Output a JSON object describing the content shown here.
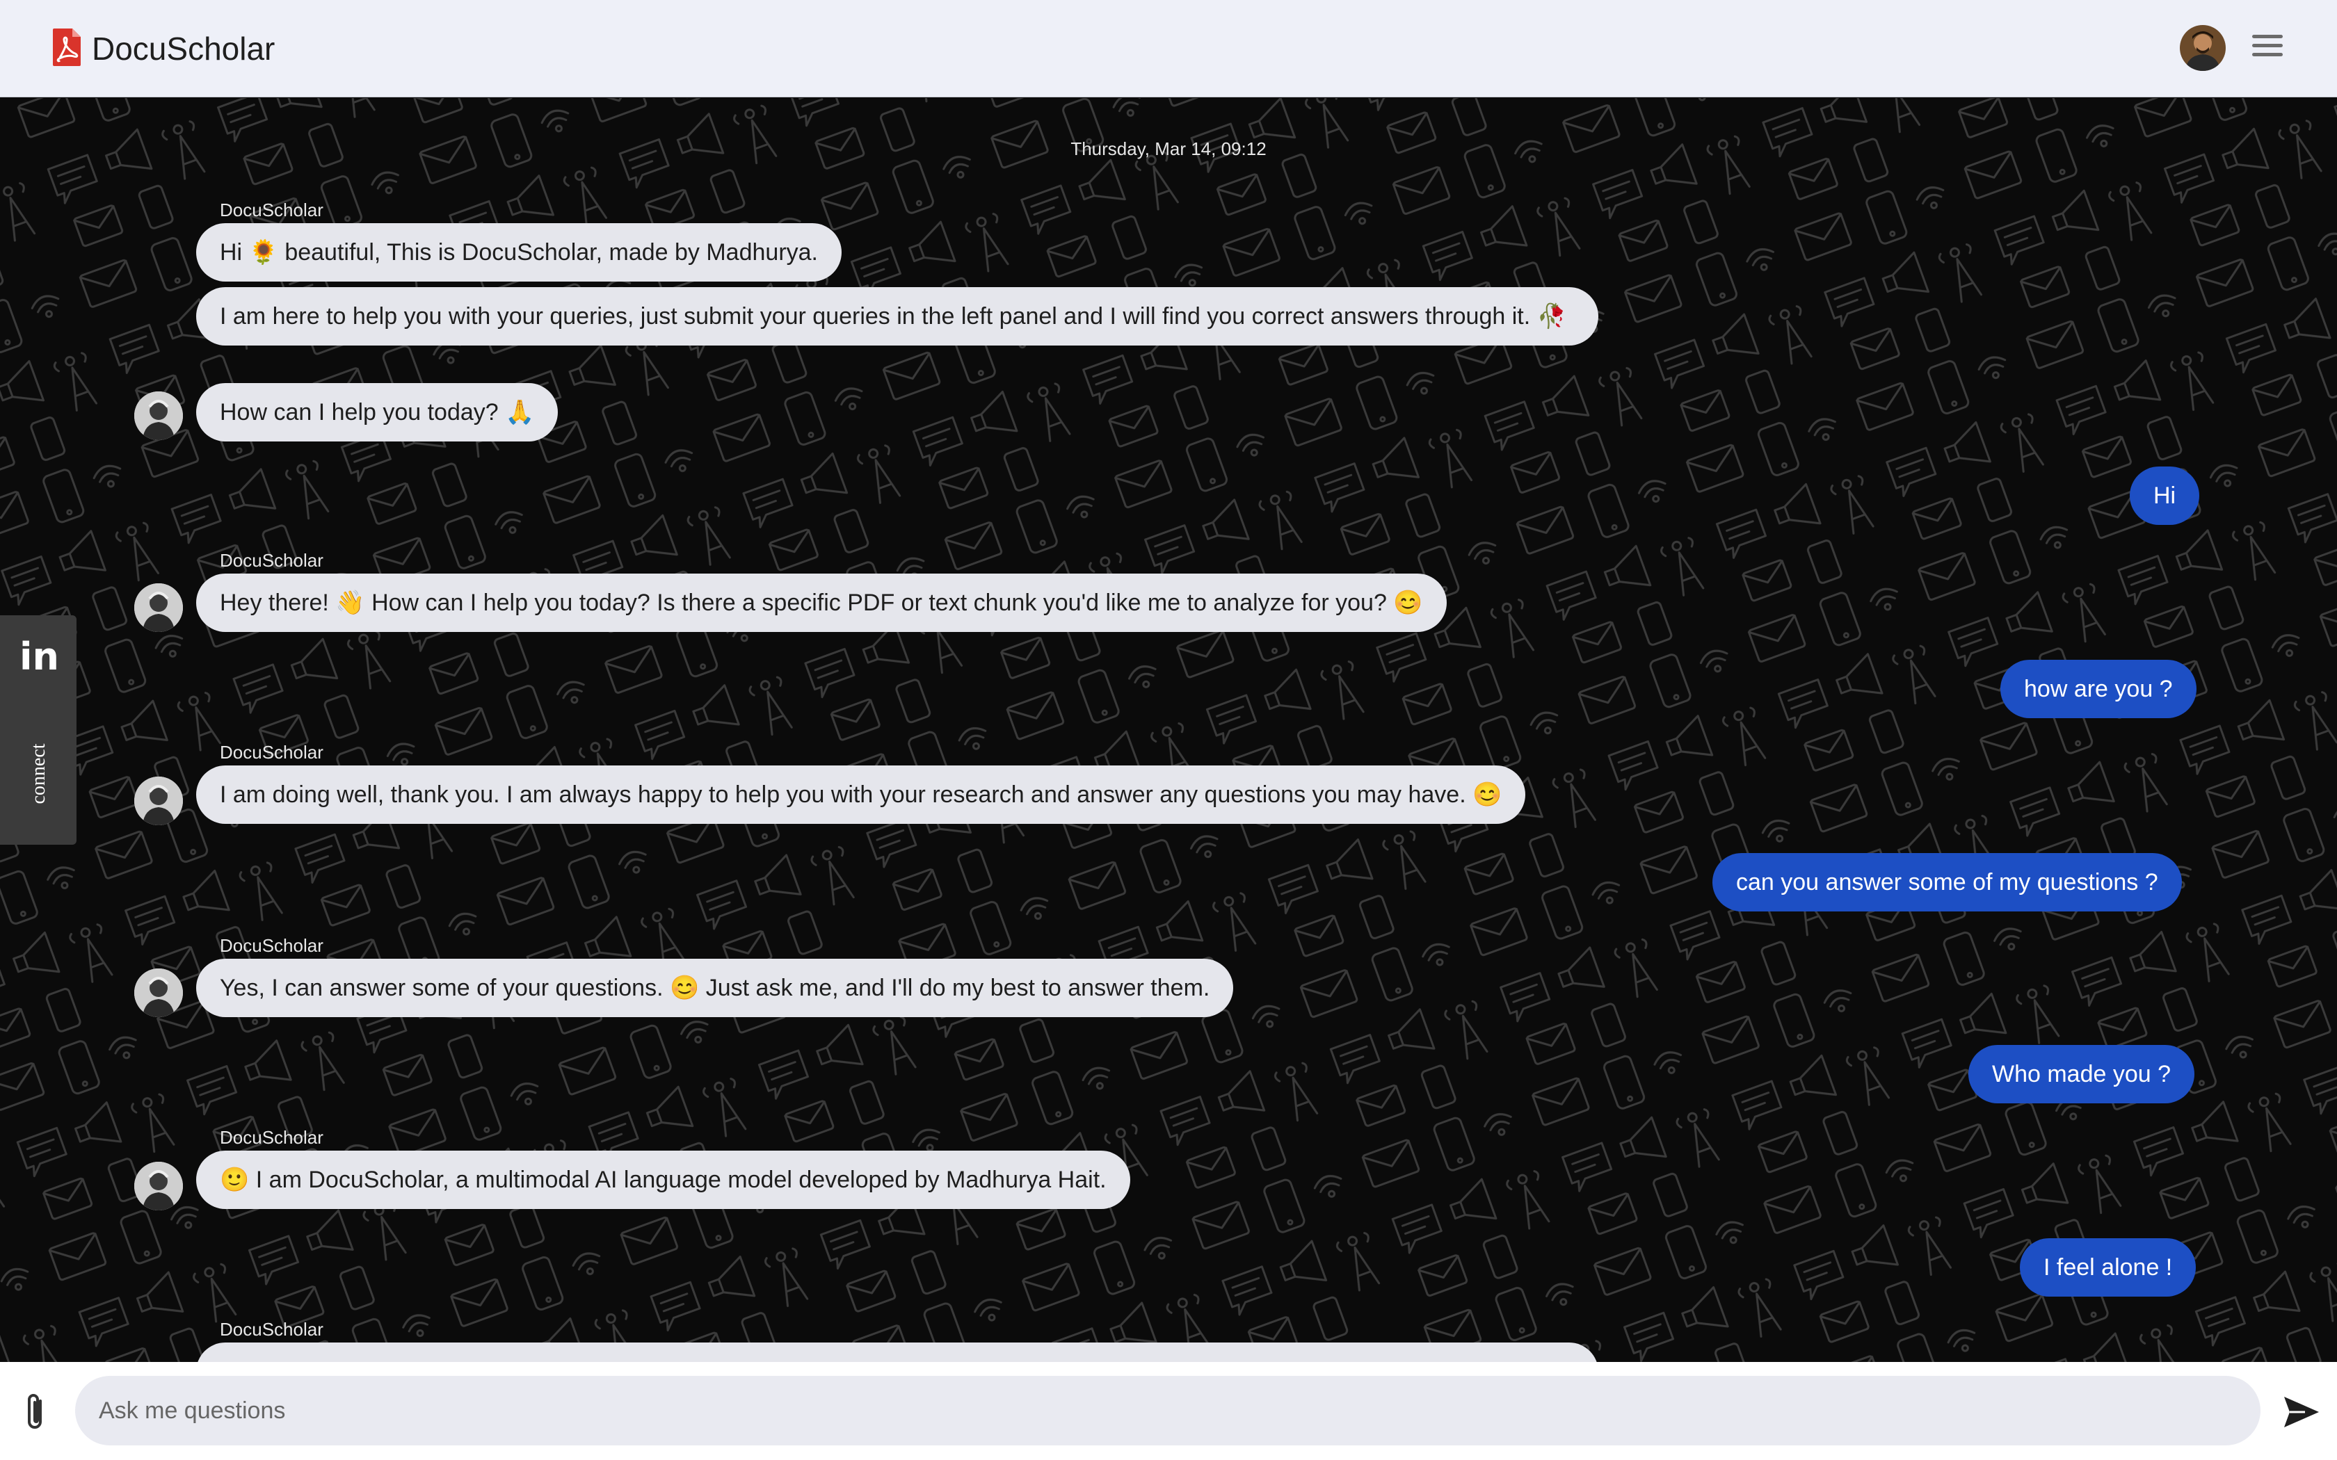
{
  "header": {
    "app_name": "DocuScholar",
    "logo_icon": "pdf-icon",
    "menu_icon": "hamburger-menu-icon"
  },
  "chat": {
    "date_stamp": "Thursday, Mar 14, 09:12",
    "sender_name": "DocuScholar",
    "messages": {
      "m1": "Hi 🌻 beautiful, This is DocuScholar, made by Madhurya.",
      "m2": "I am here to help you with your queries, just submit your queries in the left panel and I will find you correct answers through it. 🥀",
      "m3": "How can I help you today? 🙏",
      "u1": "Hi",
      "m4": "Hey there! 👋 How can I help you today? Is there a specific PDF or text chunk you'd like me to analyze for you? 😊",
      "u2": "how are you ?",
      "m5": "I am doing well, thank you. I am always happy to help you with your research and answer any questions you may have. 😊",
      "u3": "can you answer some of my questions ?",
      "m6": "Yes, I can answer some of your questions. 😊 Just ask me, and I'll do my best to answer them.",
      "u4": "Who made you ?",
      "m7": "🙂 I am DocuScholar, a multimodal AI language model developed by Madhurya Hait.",
      "u5": "I feel alone !"
    }
  },
  "sidebar_tab": {
    "icon": "linkedin-icon",
    "label": "connect"
  },
  "input": {
    "placeholder": "Ask me questions",
    "value": "",
    "attach_icon": "paperclip-icon",
    "send_icon": "send-icon"
  },
  "colors": {
    "header_bg": "#eef0f8",
    "chat_bg": "#0b0b0b",
    "bot_bubble": "#e5e6ec",
    "user_bubble": "#1d4fc4"
  }
}
